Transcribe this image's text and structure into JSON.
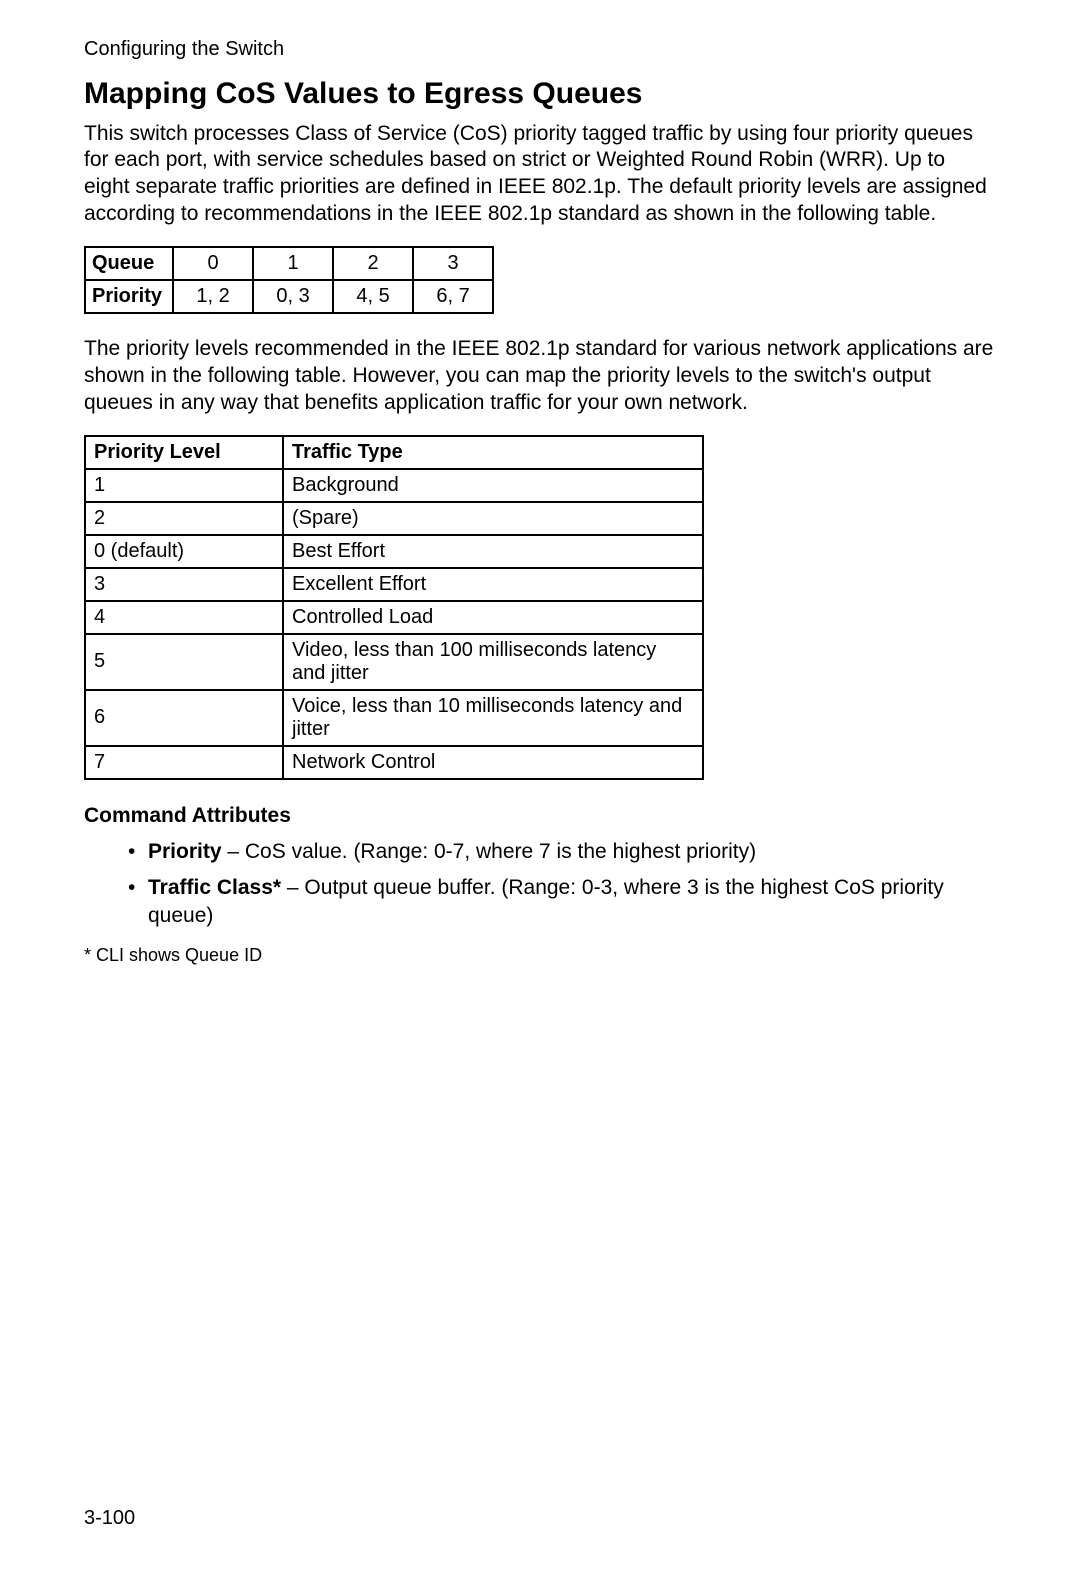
{
  "header": "Configuring the Switch",
  "heading": "Mapping CoS Values to Egress Queues",
  "paragraph1": "This switch processes Class of Service (CoS) priority tagged traffic by using four priority queues for each port, with service schedules based on strict or Weighted Round Robin (WRR). Up to eight separate traffic priorities are defined in IEEE 802.1p. The default priority levels are assigned according to recommendations in the IEEE 802.1p standard as shown in the following table.",
  "queue_table": {
    "row_headers": [
      "Queue",
      "Priority"
    ],
    "queues": [
      "0",
      "1",
      "2",
      "3"
    ],
    "priorities": [
      "1, 2",
      "0, 3",
      "4, 5",
      "6, 7"
    ]
  },
  "paragraph2": "The priority levels recommended in the IEEE 802.1p standard for various network applications are shown in the following table. However, you can map the priority levels to the switch's output queues in any way that benefits application traffic for your own network.",
  "priority_table": {
    "headers": [
      "Priority Level",
      "Traffic Type"
    ],
    "rows": [
      {
        "level": "1",
        "type": "Background"
      },
      {
        "level": "2",
        "type": "(Spare)"
      },
      {
        "level": "0 (default)",
        "type": "Best Effort"
      },
      {
        "level": "3",
        "type": "Excellent Effort"
      },
      {
        "level": "4",
        "type": "Controlled Load"
      },
      {
        "level": "5",
        "type": "Video, less than 100 milliseconds latency and jitter"
      },
      {
        "level": "6",
        "type": "Voice, less than 10 milliseconds latency and jitter"
      },
      {
        "level": "7",
        "type": "Network Control"
      }
    ]
  },
  "cmd_attr_heading": "Command Attributes",
  "attrs": [
    {
      "name": "Priority",
      "desc": " – CoS value. (Range: 0-7, where 7 is the highest priority)"
    },
    {
      "name": "Traffic Class*",
      "desc": " – Output queue buffer. (Range: 0-3, where 3 is the highest CoS priority queue)"
    }
  ],
  "footnote": "* CLI shows Queue ID",
  "page_number": "3-100"
}
